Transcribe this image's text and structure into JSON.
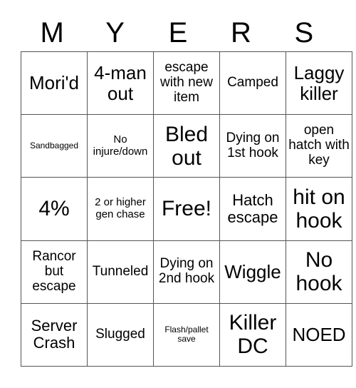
{
  "header": {
    "letters": [
      "M",
      "Y",
      "E",
      "R",
      "S"
    ]
  },
  "board": {
    "rows": [
      [
        {
          "text": "Mori'd",
          "size": "s-lg"
        },
        {
          "text": "4-man out",
          "size": "s-lg"
        },
        {
          "text": "escape with new item",
          "size": "s-md"
        },
        {
          "text": "Camped",
          "size": "s-md"
        },
        {
          "text": "Laggy killer",
          "size": "s-lg"
        }
      ],
      [
        {
          "text": "Sandbagged",
          "size": "s-xs"
        },
        {
          "text": "No injure/down",
          "size": "s-sm"
        },
        {
          "text": "Bled out",
          "size": "s-xl"
        },
        {
          "text": "Dying on 1st hook",
          "size": "s-md"
        },
        {
          "text": "open hatch with key",
          "size": "s-md"
        }
      ],
      [
        {
          "text": "4%",
          "size": "s-xl"
        },
        {
          "text": "2 or higher gen chase",
          "size": "s-sm"
        },
        {
          "text": "Free!",
          "size": "s-xl"
        },
        {
          "text": "Hatch escape",
          "size": "s-ml"
        },
        {
          "text": "hit on hook",
          "size": "s-xl"
        }
      ],
      [
        {
          "text": "Rancor but escape",
          "size": "s-md"
        },
        {
          "text": "Tunneled",
          "size": "s-md"
        },
        {
          "text": "Dying on 2nd hook",
          "size": "s-md"
        },
        {
          "text": "Wiggle",
          "size": "s-lg"
        },
        {
          "text": "No hook",
          "size": "s-xl"
        }
      ],
      [
        {
          "text": "Server Crash",
          "size": "s-ml"
        },
        {
          "text": "Slugged",
          "size": "s-md"
        },
        {
          "text": "Flash/pallet save",
          "size": "s-xs"
        },
        {
          "text": "Killer DC",
          "size": "s-xl"
        },
        {
          "text": "NOED",
          "size": "s-lg"
        }
      ]
    ]
  }
}
